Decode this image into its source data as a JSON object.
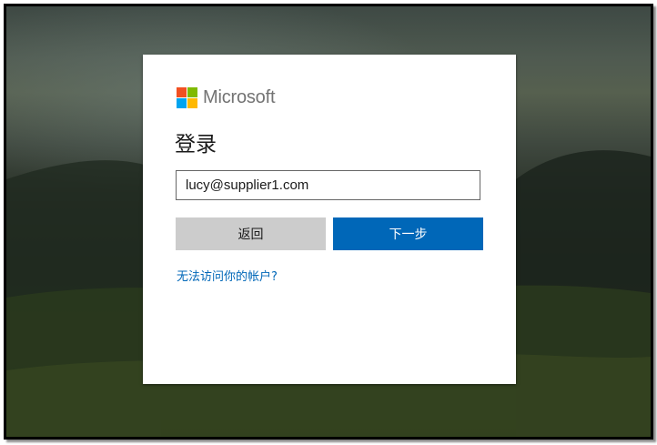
{
  "brand": {
    "name": "Microsoft",
    "icon": "microsoft-logo-icon",
    "colors": {
      "red": "#f25022",
      "green": "#7fba00",
      "blue": "#00a4ef",
      "yellow": "#ffb900"
    }
  },
  "signin": {
    "title": "登录",
    "email_value": "lucy@supplier1.com",
    "back_label": "返回",
    "next_label": "下一步",
    "help_link": "无法访问你的帐户?"
  },
  "theme": {
    "accent": "#0067b8",
    "back_button_bg": "#cccccc"
  }
}
